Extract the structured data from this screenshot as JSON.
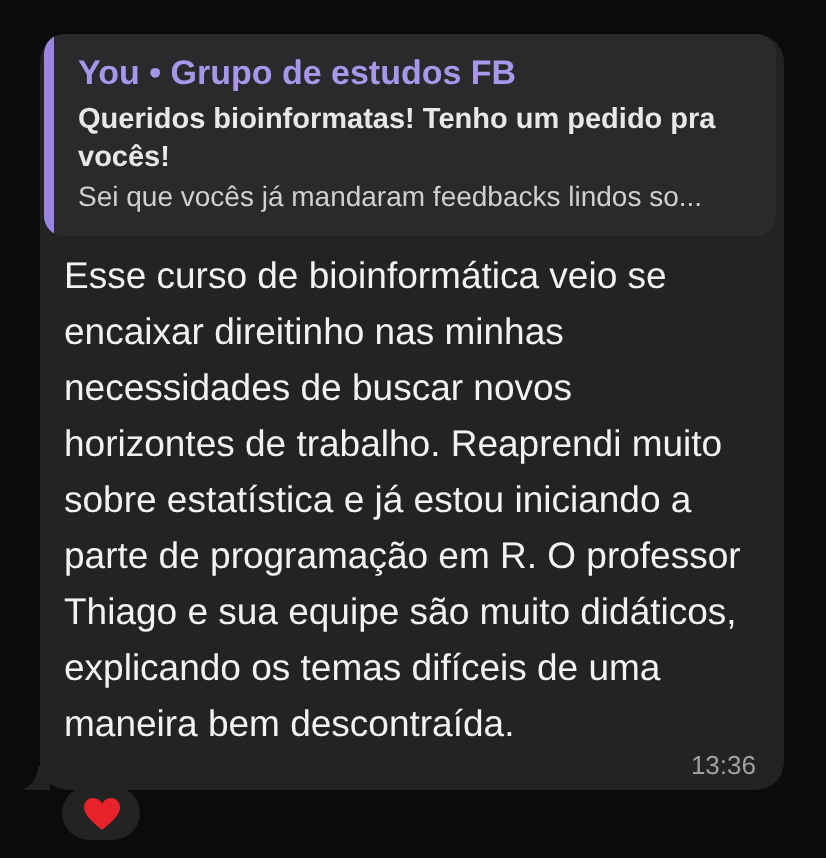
{
  "message": {
    "quote": {
      "author": "You • Grupo de estudos FB",
      "title": "Queridos bioinformatas! Tenho um pedido pra vocês!",
      "preview": "Sei que vocês já mandaram feedbacks lindos so..."
    },
    "text": "Esse curso de bioinformática veio se encaixar direitinho nas minhas necessidades de buscar novos horizontes de trabalho. Reaprendi muito sobre estatística e já estou iniciando a parte de programação em R. O professor Thiago e sua equipe são muito didáticos, explicando os temas difíceis de uma maneira bem descontraída.",
    "time": "13:36",
    "reactions": [
      {
        "kind": "heart"
      }
    ]
  }
}
